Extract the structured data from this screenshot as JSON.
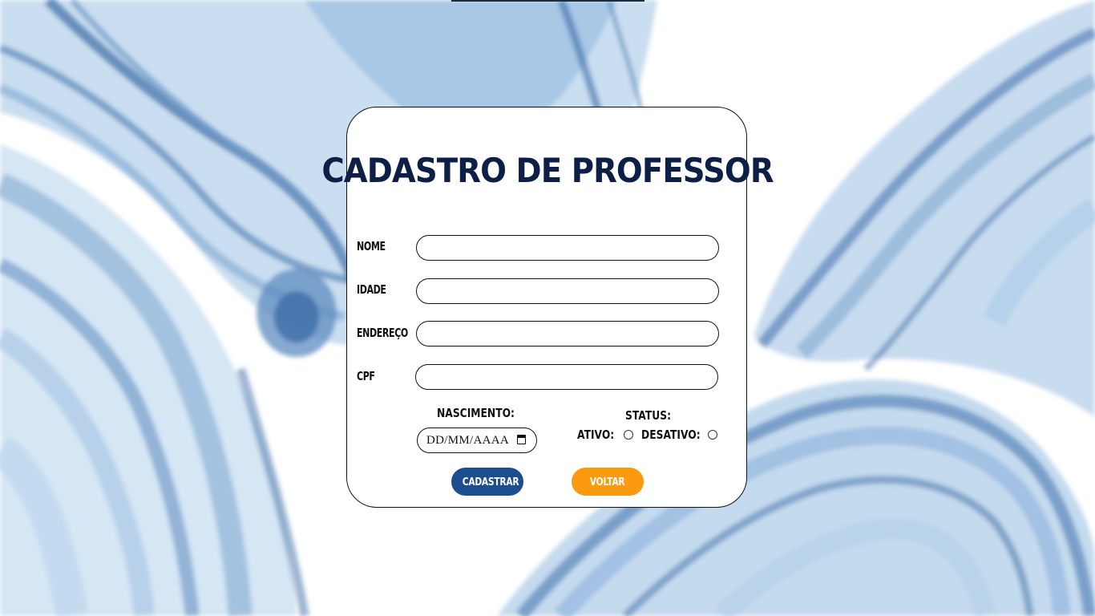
{
  "page": {
    "title": "CADASTRO DE PROFESSOR"
  },
  "form": {
    "fields": [
      {
        "label": "NOME",
        "value": ""
      },
      {
        "label": "IDADE",
        "value": ""
      },
      {
        "label": "ENDEREÇO",
        "value": ""
      },
      {
        "label": "CPF",
        "value": ""
      }
    ],
    "birth": {
      "label": "NASCIMENTO:",
      "placeholder": "DD/MM/AAAA",
      "icon": "calendar-icon"
    },
    "status": {
      "label": "STATUS:",
      "active_label": "ATIVO:",
      "inactive_label": "DESATIVO:",
      "active_checked": false,
      "inactive_checked": false
    }
  },
  "buttons": {
    "submit_label": "CADASTRAR",
    "back_label": "VOLTAR"
  },
  "colors": {
    "title": "#0d1f47",
    "submit_button": "#1c4e8f",
    "back_button": "#fb9a0e",
    "background_watercolor": "#8fb6da"
  }
}
